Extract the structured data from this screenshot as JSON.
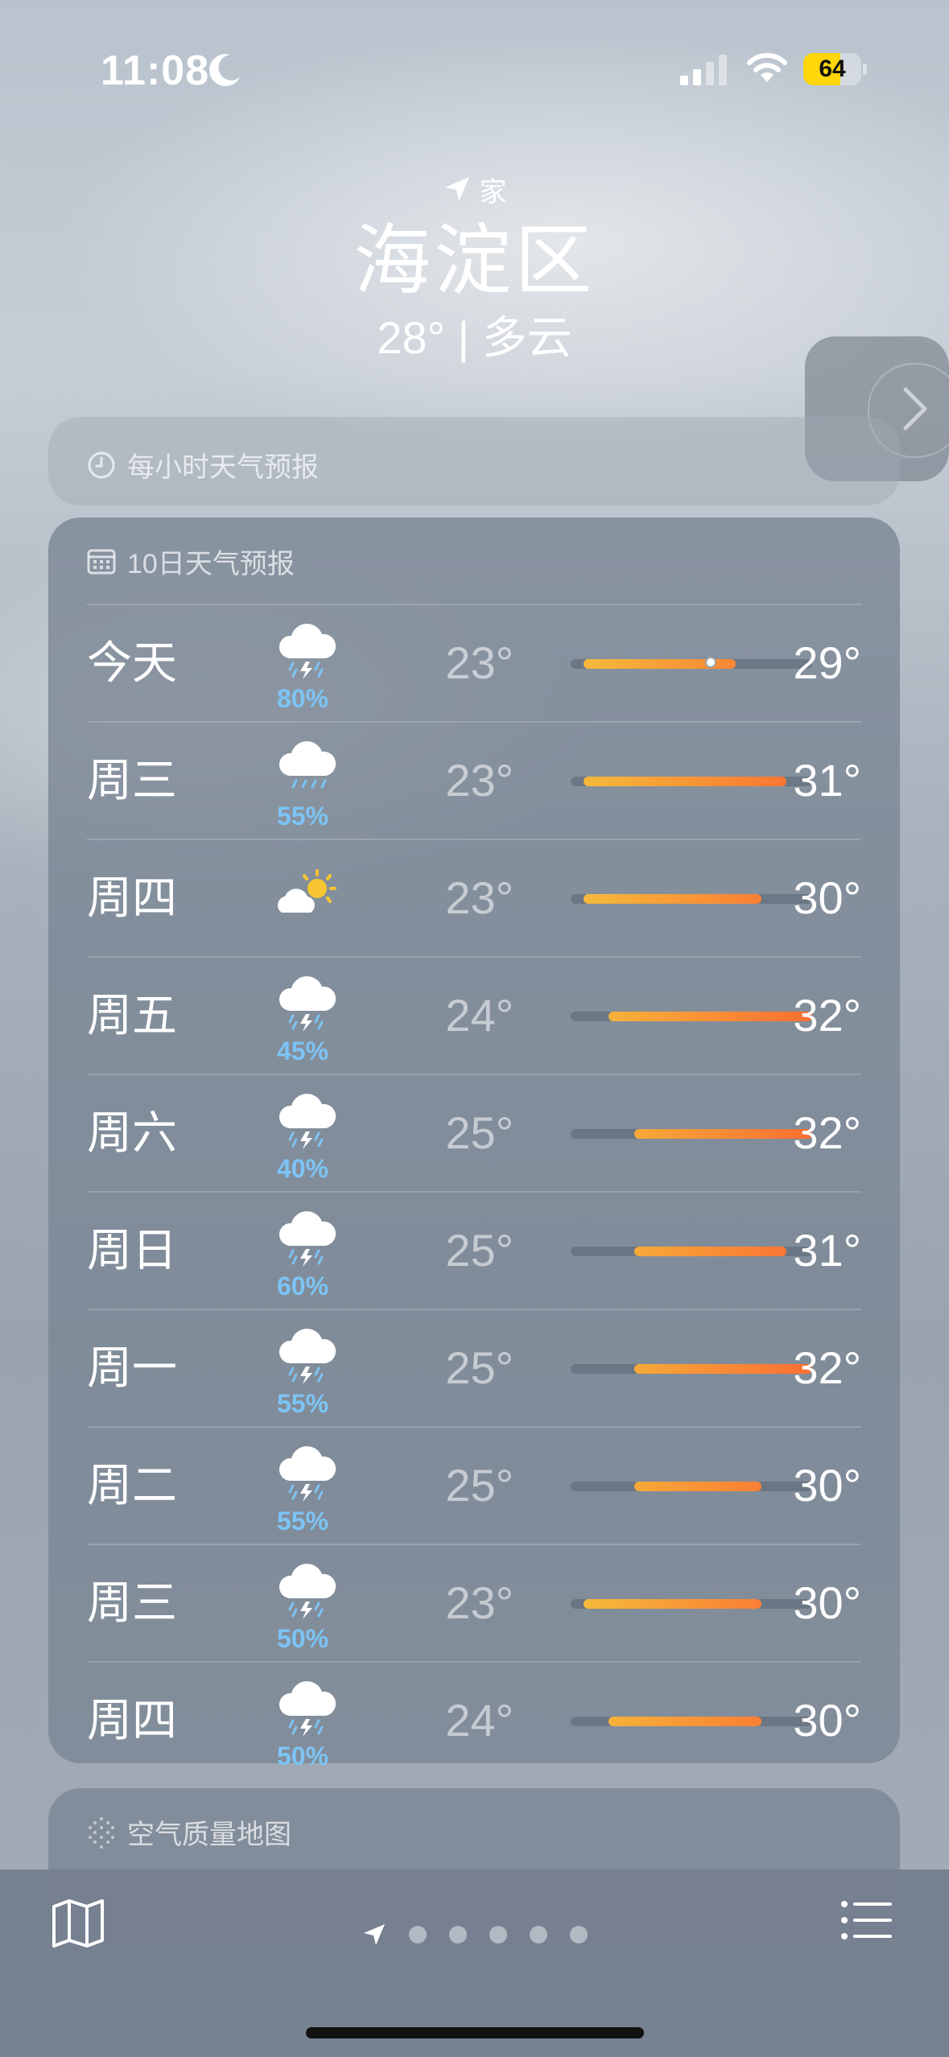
{
  "status_bar": {
    "time": "11:08",
    "battery": "64",
    "battery_level": 0.64
  },
  "location": {
    "label": "家",
    "city": "海淀区",
    "current": "28° | 多云"
  },
  "hourly_card": {
    "title": "每小时天气预报"
  },
  "forecast_card": {
    "title": "10日天气预报"
  },
  "forecast": [
    {
      "day": "今天",
      "icon": "thunderstorm-icon",
      "precip": "80%",
      "low": "23°",
      "high": "29°",
      "range": [
        23,
        29
      ],
      "current_temp": 28
    },
    {
      "day": "周三",
      "icon": "rain-icon",
      "precip": "55%",
      "low": "23°",
      "high": "31°",
      "range": [
        23,
        31
      ]
    },
    {
      "day": "周四",
      "icon": "partly-sunny-icon",
      "precip": "",
      "low": "23°",
      "high": "30°",
      "range": [
        23,
        30
      ]
    },
    {
      "day": "周五",
      "icon": "thunderstorm-icon",
      "precip": "45%",
      "low": "24°",
      "high": "32°",
      "range": [
        24,
        32
      ]
    },
    {
      "day": "周六",
      "icon": "thunderstorm-icon",
      "precip": "40%",
      "low": "25°",
      "high": "32°",
      "range": [
        25,
        32
      ]
    },
    {
      "day": "周日",
      "icon": "thunderstorm-icon",
      "precip": "60%",
      "low": "25°",
      "high": "31°",
      "range": [
        25,
        31
      ]
    },
    {
      "day": "周一",
      "icon": "thunderstorm-icon",
      "precip": "55%",
      "low": "25°",
      "high": "32°",
      "range": [
        25,
        32
      ]
    },
    {
      "day": "周二",
      "icon": "thunderstorm-icon",
      "precip": "55%",
      "low": "25°",
      "high": "30°",
      "range": [
        25,
        30
      ]
    },
    {
      "day": "周三",
      "icon": "thunderstorm-icon",
      "precip": "50%",
      "low": "23°",
      "high": "30°",
      "range": [
        23,
        30
      ]
    },
    {
      "day": "周四",
      "icon": "thunderstorm-icon",
      "precip": "50%",
      "low": "24°",
      "high": "30°",
      "range": [
        24,
        30
      ]
    }
  ],
  "temp_scale": {
    "min": 22.5,
    "max": 32
  },
  "air_card": {
    "title": "空气质量地图"
  },
  "tab_bar": {
    "page_dots": 5
  }
}
